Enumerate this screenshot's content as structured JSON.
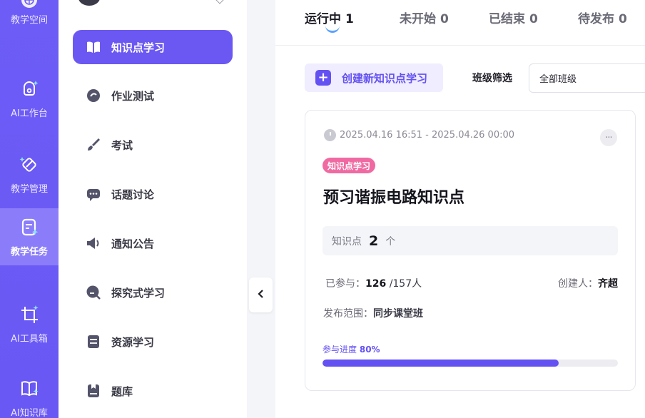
{
  "rail": {
    "items": [
      {
        "label": "教学空间"
      },
      {
        "label": "AI工作台"
      },
      {
        "label": "教学管理"
      },
      {
        "label": "教学任务"
      },
      {
        "label": "AI工具箱"
      },
      {
        "label": "AI知识库"
      }
    ],
    "active_index": 3
  },
  "menu": {
    "items": [
      {
        "label": "知识点学习",
        "icon": "book-icon"
      },
      {
        "label": "作业测试",
        "icon": "homework-icon"
      },
      {
        "label": "考试",
        "icon": "brush-icon"
      },
      {
        "label": "话题讨论",
        "icon": "chat-icon"
      },
      {
        "label": "通知公告",
        "icon": "megaphone-icon"
      },
      {
        "label": "探究式学习",
        "icon": "explore-icon"
      },
      {
        "label": "资源学习",
        "icon": "resource-icon"
      },
      {
        "label": "题库",
        "icon": "question-bank-icon"
      }
    ],
    "active_index": 0
  },
  "tabs": [
    {
      "label": "运行中",
      "count": "1"
    },
    {
      "label": "未开始",
      "count": "0"
    },
    {
      "label": "已结束",
      "count": "0"
    },
    {
      "label": "待发布",
      "count": "0"
    }
  ],
  "toolbar": {
    "create_label": "创建新知识点学习",
    "filter_label": "班级筛选",
    "filter_value": "全部班级"
  },
  "card": {
    "time_range": "2025.04.16 16:51 - 2025.04.26 00:00",
    "more": "···",
    "tag": "知识点学习",
    "title": "预习谐振电路知识点",
    "kp_label": "知识点",
    "kp_count": "2",
    "kp_unit": "个",
    "participated_label": "已参与：",
    "participated": "126",
    "total": "/157人",
    "creator_label": "创建人：",
    "creator": "齐超",
    "scope_label": "发布范围：",
    "scope": "同步课堂班",
    "progress_label": "参与进度",
    "progress_text": "80%",
    "progress": 0.8
  },
  "colors": {
    "accent": "#6451f2",
    "tag": "#f06aa2"
  }
}
